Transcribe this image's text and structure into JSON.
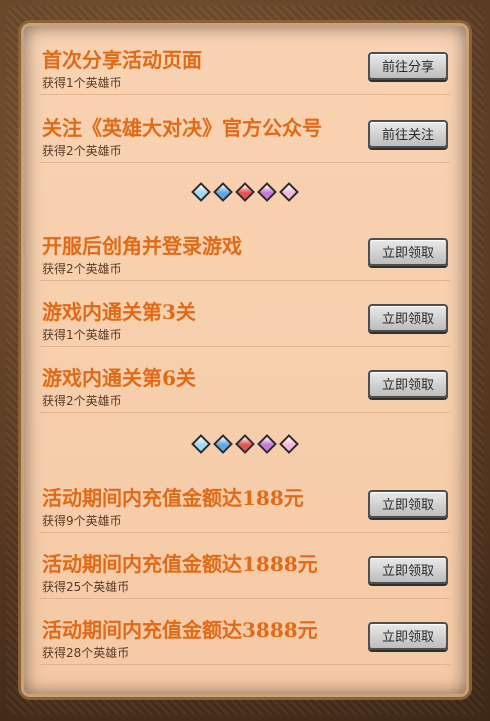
{
  "tasks_top": [
    {
      "title": "首次分享活动页面",
      "reward": "获得1个英雄币",
      "button": "前往分享"
    },
    {
      "title": "关注《英雄大对决》官方公众号",
      "reward": "获得2个英雄币",
      "button": "前往关注"
    }
  ],
  "tasks_game": [
    {
      "title": "开服后创角并登录游戏",
      "reward": "获得2个英雄币",
      "button": "立即领取"
    },
    {
      "title": "游戏内通关第3关",
      "reward": "获得1个英雄币",
      "button": "立即领取"
    },
    {
      "title": "游戏内通关第6关",
      "reward": "获得2个英雄币",
      "button": "立即领取"
    }
  ],
  "tasks_recharge": [
    {
      "title": "活动期间内充值金额达188元",
      "reward": "获得9个英雄币",
      "button": "立即领取"
    },
    {
      "title": "活动期间内充值金额达1888元",
      "reward": "获得25个英雄币",
      "button": "立即领取"
    },
    {
      "title": "活动期间内充值金额达3888元",
      "reward": "获得28个英雄币",
      "button": "立即领取"
    }
  ],
  "divider_gem_colors": [
    "#9fd8ef",
    "#5aa9e6",
    "#e8514f",
    "#c77ad6",
    "#f2b8d6"
  ]
}
